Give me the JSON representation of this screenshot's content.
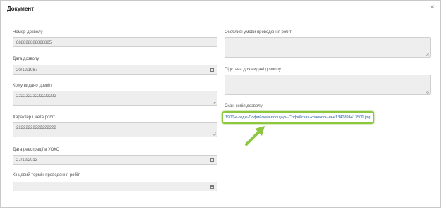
{
  "dialog": {
    "title": "Документ",
    "close_label": "×"
  },
  "fields": {
    "permit_number": {
      "label": "Номер дозволу",
      "value": "888888888888885"
    },
    "permit_date": {
      "label": "Дата дозволу",
      "value": "20/12/1987"
    },
    "issued_to": {
      "label": "Кому видано дозвіл",
      "value": "22222222222222222"
    },
    "work_nature": {
      "label": "Характер і мета робіт",
      "value": "22222222222222222"
    },
    "registration_date": {
      "label": "Дата реєстрації в УОКС",
      "value": "27/12/2013"
    },
    "end_date": {
      "label": "Кінцевий термін проведення робіт",
      "value": ""
    },
    "special_conditions": {
      "label": "Особливі умови проведення робіт",
      "value": ""
    },
    "grounds": {
      "label": "Підстава для видачі дозволу",
      "value": ""
    },
    "scan_copy": {
      "label": "Скан-копія дозволу",
      "file_name": "1900-е-годы-Софийская-площадь-Софийская-колокольня-e1340896417501.jpg"
    }
  },
  "accent": {
    "highlight": "#8dc63f",
    "link": "#2a62a8"
  }
}
